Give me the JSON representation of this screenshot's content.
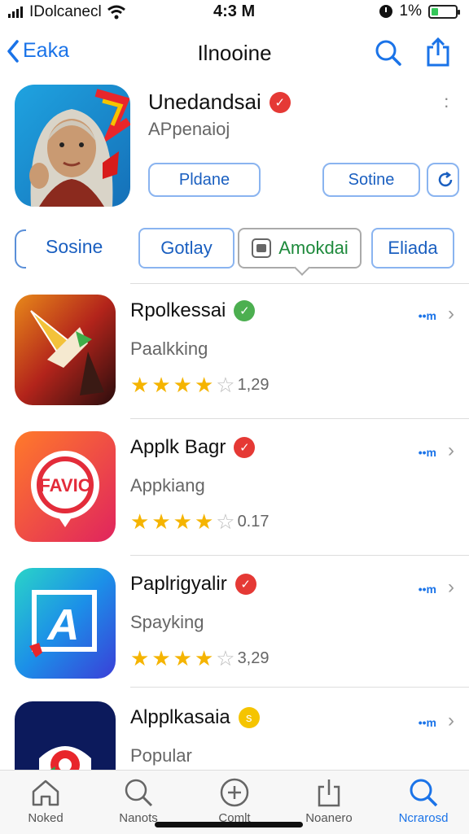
{
  "status": {
    "carrier": "IDolcanecl",
    "time": "4:3 M",
    "battery": "1%"
  },
  "nav": {
    "back_label": "Eaka",
    "title": "Ilnooine"
  },
  "featured": {
    "name": "Unedandsai",
    "subtitle": "APpenaioj",
    "button_primary": "Pldane",
    "button_secondary": "Sotine"
  },
  "categories": {
    "first": "Sosine",
    "tabs": [
      "Gotlay",
      "Amokdai",
      "Eliada"
    ]
  },
  "apps": [
    {
      "name": "Rpolkessai",
      "category": "Paalkking",
      "rating_value": "1,29",
      "stars": 4,
      "badge_color": "#4caf50",
      "badge_glyph": "✓",
      "get_label": "••m"
    },
    {
      "name": "Applk Bagr",
      "category": "Appkiang",
      "rating_value": "0.17",
      "stars": 4,
      "badge_color": "#e53935",
      "badge_glyph": "✓",
      "get_label": "••m",
      "icon_text": "FAVIC"
    },
    {
      "name": "Paplrigyalir",
      "category": "Spayking",
      "rating_value": "3,29",
      "stars": 4,
      "badge_color": "#e53935",
      "badge_glyph": "✓",
      "get_label": "••m",
      "icon_text": "A"
    },
    {
      "name": "Alpplkasaia",
      "category": "Popular",
      "rating_value": "",
      "stars": 0,
      "badge_color": "#f5c400",
      "badge_glyph": "s",
      "get_label": "••m"
    }
  ],
  "tabbar": [
    "Noked",
    "Nanots",
    "Comlt",
    "Noanero",
    "Ncrarosd"
  ]
}
